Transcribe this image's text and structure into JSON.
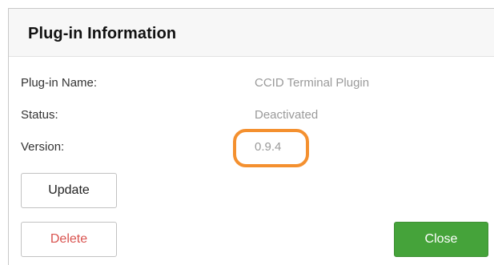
{
  "dialog": {
    "title": "Plug-in Information",
    "fields": [
      {
        "label": "Plug-in Name:",
        "value": "CCID Terminal Plugin"
      },
      {
        "label": "Status:",
        "value": "Deactivated"
      },
      {
        "label": "Version:",
        "value": "0.9.4"
      }
    ],
    "buttons": {
      "update": "Update",
      "delete": "Delete",
      "close": "Close"
    },
    "colors": {
      "close_button": "#45a33a",
      "delete_text": "#d9534f",
      "highlight": "#f4902f"
    }
  }
}
